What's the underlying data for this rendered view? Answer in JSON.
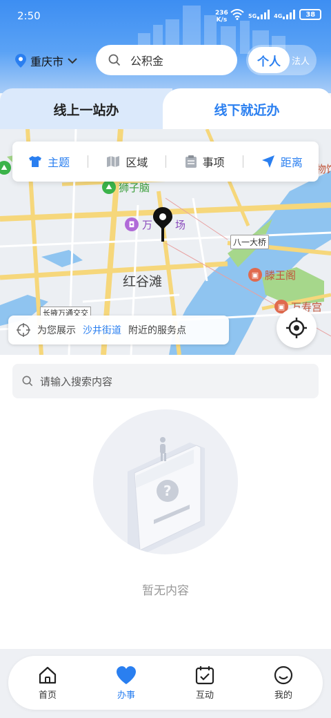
{
  "status_bar": {
    "time": "2:50",
    "net_speed_value": "236",
    "net_speed_unit": "K/s",
    "signal_1": "5G",
    "signal_2": "4G",
    "battery": "38"
  },
  "header": {
    "city": "重庆市",
    "search_text": "公积金",
    "role_active": "个人",
    "role_inactive": "法人"
  },
  "tabs": {
    "left": "线上一站办",
    "right": "线下就近办"
  },
  "filters": [
    {
      "label": "主题",
      "icon": "shirt-icon"
    },
    {
      "label": "区域",
      "icon": "map-icon"
    },
    {
      "label": "事项",
      "icon": "clipboard-icon"
    },
    {
      "label": "距离",
      "icon": "navigation-arrow-icon"
    }
  ],
  "map": {
    "labels": {
      "lion_head": "狮子脑",
      "wanda_1": "万",
      "wanda_2": "场",
      "bayi_bridge": "八一大桥",
      "hongguttan": "红谷滩",
      "tengwang": "滕王阁",
      "wanshou": "万寿宫",
      "changjing": "长掖万通交交",
      "edge_top_right": "物馆"
    },
    "hint": {
      "prefix": "为您展示",
      "street": "沙井街道",
      "suffix": "附近的服务点"
    },
    "colors": {
      "water": "#8fc4f0",
      "road_major": "#f6d77b",
      "road_minor": "#ffffff",
      "land": "#eceff3"
    }
  },
  "content": {
    "search_placeholder": "请输入搜索内容",
    "empty_text": "暂无内容"
  },
  "bottom_nav": [
    {
      "label": "首页",
      "icon": "home-icon",
      "active": false
    },
    {
      "label": "办事",
      "icon": "heart-icon",
      "active": true
    },
    {
      "label": "互动",
      "icon": "calendar-check-icon",
      "active": false
    },
    {
      "label": "我的",
      "icon": "smile-icon",
      "active": false
    }
  ],
  "colors": {
    "accent": "#2a7ff0",
    "header_top": "#3d8ef2"
  }
}
